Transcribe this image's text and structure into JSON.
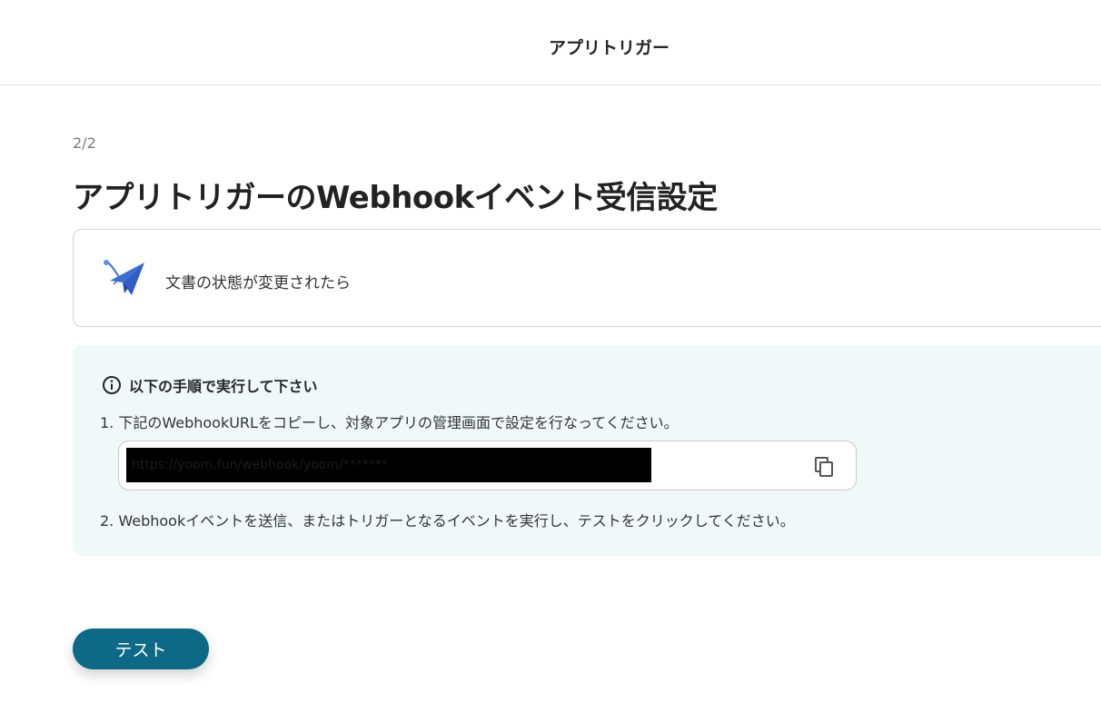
{
  "header": {
    "title": "アプリトリガー"
  },
  "page": {
    "step": "2/2",
    "title": "アプリトリガーのWebhookイベント受信設定"
  },
  "trigger": {
    "icon": "paper-plane-icon",
    "label": "文書の状態が変更されたら"
  },
  "instructions": {
    "heading": "以下の手順で実行して下さい",
    "step1": "1. 下記のWebhookURLをコピーし、対象アプリの管理画面で設定を行なってください。",
    "webhook_url": "https://yoom.fun/webhook/yoom/*******",
    "step2": "2. Webhookイベントを送信、またはトリガーとなるイベントを実行し、テストをクリックしてください。"
  },
  "actions": {
    "test_label": "テスト"
  },
  "colors": {
    "primary_button": "#0c6a86",
    "info_background": "#f0f9f8",
    "icon_blue": "#3a6fd8"
  }
}
